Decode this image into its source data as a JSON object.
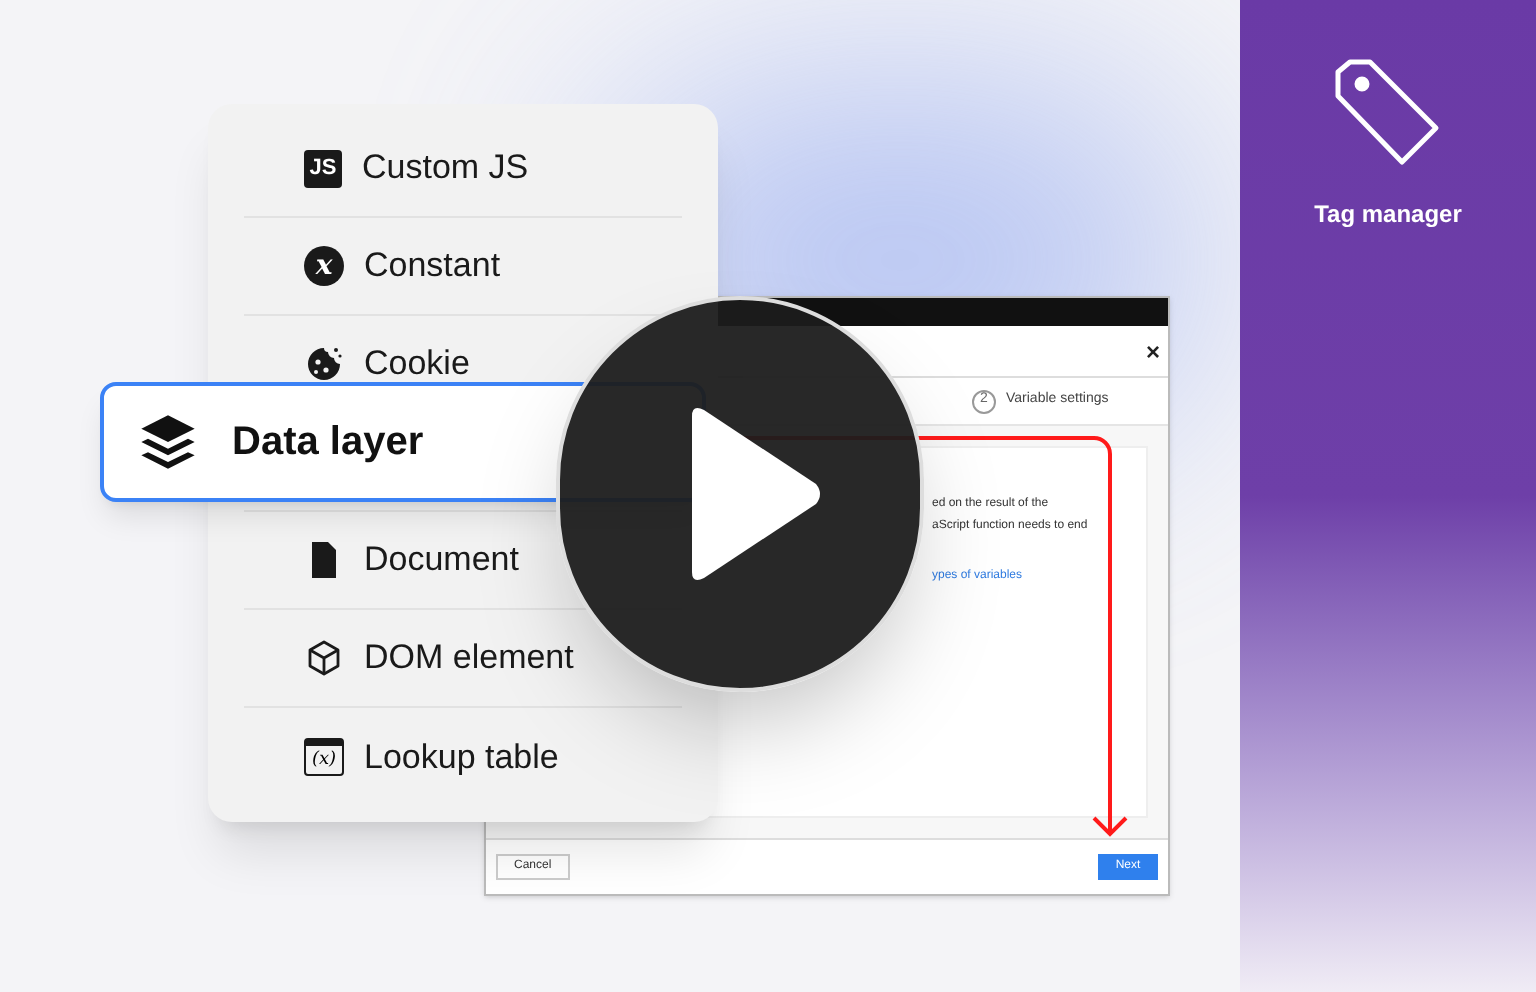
{
  "menu": {
    "items": [
      {
        "kind": "js",
        "icon_text": "JS",
        "label": "Custom JS",
        "selected": false
      },
      {
        "kind": "constant",
        "icon_text": "x",
        "label": "Constant",
        "selected": false
      },
      {
        "kind": "cookie",
        "label": "Cookie",
        "selected": false
      },
      {
        "kind": "data-layer",
        "label": "Data layer",
        "selected": true
      },
      {
        "kind": "document",
        "label": "Document",
        "selected": false
      },
      {
        "kind": "dom",
        "label": "DOM element",
        "selected": false
      },
      {
        "kind": "lookup",
        "icon_text": "(x)",
        "label": "Lookup table",
        "selected": false
      }
    ]
  },
  "dialog": {
    "close": "×",
    "step": {
      "number": "2",
      "label": "Variable settings"
    },
    "description_lines": [
      "ed on the result of the",
      "aScript function needs to end"
    ],
    "link": "ypes of variables",
    "cancel": "Cancel",
    "next": "Next"
  },
  "side_panel": {
    "title": "Tag manager"
  }
}
